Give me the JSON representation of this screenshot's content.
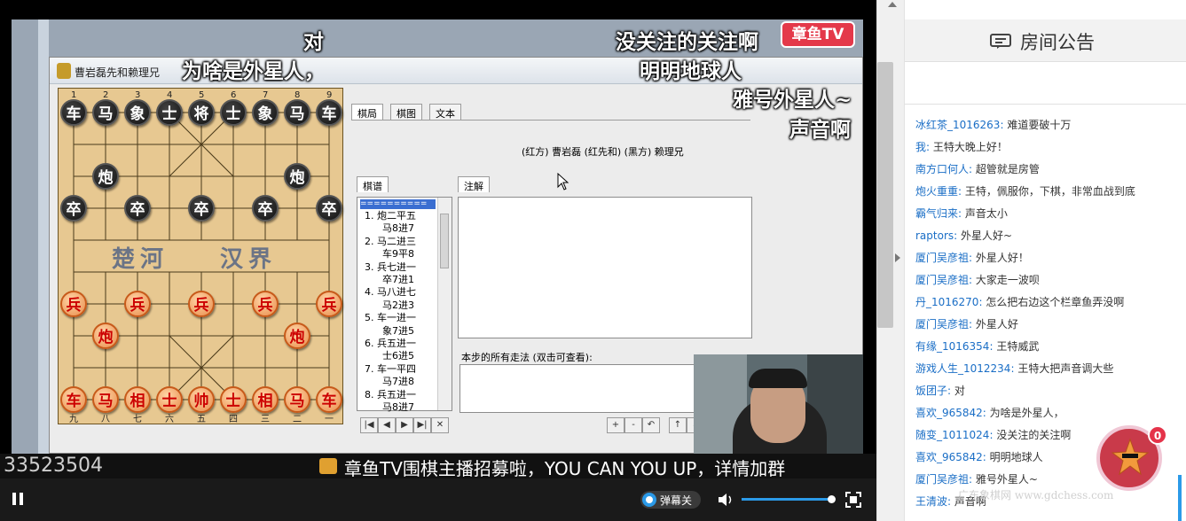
{
  "danmaku": [
    "对",
    "为啥是外星人，",
    "没关注的关注啊",
    "明明地球人",
    "雅号外星人~",
    "声音啊"
  ],
  "brand_logo": "章鱼TV",
  "window": {
    "title": "曹岩磊先和赖理兄",
    "tabs": [
      "棋局",
      "棋图",
      "文本"
    ],
    "header_line": "(红方) 曹岩磊 (红先和) (黑方) 赖理兄",
    "record_tab": "棋谱",
    "note_tab": "注解",
    "record_separator": "==========",
    "moves": [
      "1. 炮二平五",
      "马8进7",
      "2. 马二进三",
      "车9平8",
      "3. 兵七进一",
      "卒7进1",
      "4. 马八进七",
      "马2进3",
      "5. 车一进一",
      "象7进5",
      "6. 兵五进一",
      "士6进5",
      "7. 车一平四",
      "马7进8",
      "8. 兵五进一",
      "马8进7"
    ],
    "all_moves_label": "本步的所有走法 (双击可查看):",
    "nav_buttons": [
      "|◀",
      "◀",
      "▶",
      "▶|",
      "✕"
    ],
    "note_buttons": [
      "+",
      "-",
      "↶",
      "↑",
      "↓"
    ],
    "river_left": "楚河",
    "river_right": "汉界",
    "col_top": [
      "1",
      "2",
      "3",
      "4",
      "5",
      "6",
      "7",
      "8",
      "9"
    ],
    "col_bottom": [
      "九",
      "八",
      "七",
      "六",
      "五",
      "四",
      "三",
      "二",
      "一"
    ],
    "black_pieces": [
      {
        "t": "车",
        "c": 0,
        "r": 0
      },
      {
        "t": "马",
        "c": 1,
        "r": 0
      },
      {
        "t": "象",
        "c": 2,
        "r": 0
      },
      {
        "t": "士",
        "c": 3,
        "r": 0
      },
      {
        "t": "将",
        "c": 4,
        "r": 0
      },
      {
        "t": "士",
        "c": 5,
        "r": 0
      },
      {
        "t": "象",
        "c": 6,
        "r": 0
      },
      {
        "t": "马",
        "c": 7,
        "r": 0
      },
      {
        "t": "车",
        "c": 8,
        "r": 0
      },
      {
        "t": "炮",
        "c": 1,
        "r": 2
      },
      {
        "t": "炮",
        "c": 7,
        "r": 2
      },
      {
        "t": "卒",
        "c": 0,
        "r": 3
      },
      {
        "t": "卒",
        "c": 2,
        "r": 3
      },
      {
        "t": "卒",
        "c": 4,
        "r": 3
      },
      {
        "t": "卒",
        "c": 6,
        "r": 3
      },
      {
        "t": "卒",
        "c": 8,
        "r": 3
      }
    ],
    "red_pieces": [
      {
        "t": "兵",
        "c": 0,
        "r": 6
      },
      {
        "t": "兵",
        "c": 2,
        "r": 6
      },
      {
        "t": "兵",
        "c": 4,
        "r": 6
      },
      {
        "t": "兵",
        "c": 6,
        "r": 6
      },
      {
        "t": "兵",
        "c": 8,
        "r": 6
      },
      {
        "t": "炮",
        "c": 1,
        "r": 7
      },
      {
        "t": "炮",
        "c": 7,
        "r": 7
      },
      {
        "t": "车",
        "c": 0,
        "r": 9
      },
      {
        "t": "马",
        "c": 1,
        "r": 9
      },
      {
        "t": "相",
        "c": 2,
        "r": 9
      },
      {
        "t": "士",
        "c": 3,
        "r": 9
      },
      {
        "t": "帅",
        "c": 4,
        "r": 9
      },
      {
        "t": "士",
        "c": 5,
        "r": 9
      },
      {
        "t": "相",
        "c": 6,
        "r": 9
      },
      {
        "t": "马",
        "c": 7,
        "r": 9
      },
      {
        "t": "车",
        "c": 8,
        "r": 9
      }
    ]
  },
  "ticker": {
    "left": "33523504",
    "right": "章鱼TV围棋主播招募啦，YOU CAN YOU UP，详情加群"
  },
  "controls": {
    "danmaku_toggle": "弹幕关",
    "volume": 1.0
  },
  "chat": {
    "title": "房间公告",
    "badge": "0",
    "watermark": "广东象棋网 www.gdchess.com",
    "messages": [
      {
        "user": "冰红茶_1016263:",
        "text": "难道要破十万"
      },
      {
        "user": "我:",
        "text": "王特大晚上好！"
      },
      {
        "user": "南方口何人:",
        "text": "超管就是房管"
      },
      {
        "user": "炮火重重:",
        "text": "王特，佩服你，下棋，非常血战到底"
      },
      {
        "user": "霸气归来:",
        "text": "声音太小"
      },
      {
        "user": "raptors:",
        "text": "外星人好~"
      },
      {
        "user": "厦门吴彦祖:",
        "text": "外星人好！"
      },
      {
        "user": "厦门吴彦祖:",
        "text": "大家走一波呗"
      },
      {
        "user": "丹_1016270:",
        "text": "怎么把右边这个栏章鱼弄没啊"
      },
      {
        "user": "厦门吴彦祖:",
        "text": "外星人好"
      },
      {
        "user": "有缘_1016354:",
        "text": "王特威武"
      },
      {
        "user": "游戏人生_1012234:",
        "text": "王特大把声音调大些"
      },
      {
        "user": "饭团子:",
        "text": "对"
      },
      {
        "user": "喜欢_965842:",
        "text": "为啥是外星人，"
      },
      {
        "user": "随变_1011024:",
        "text": "没关注的关注啊"
      },
      {
        "user": "喜欢_965842:",
        "text": "明明地球人"
      },
      {
        "user": "厦门吴彦祖:",
        "text": "雅号外星人~"
      },
      {
        "user": "王清波:",
        "text": "声音啊"
      }
    ]
  }
}
